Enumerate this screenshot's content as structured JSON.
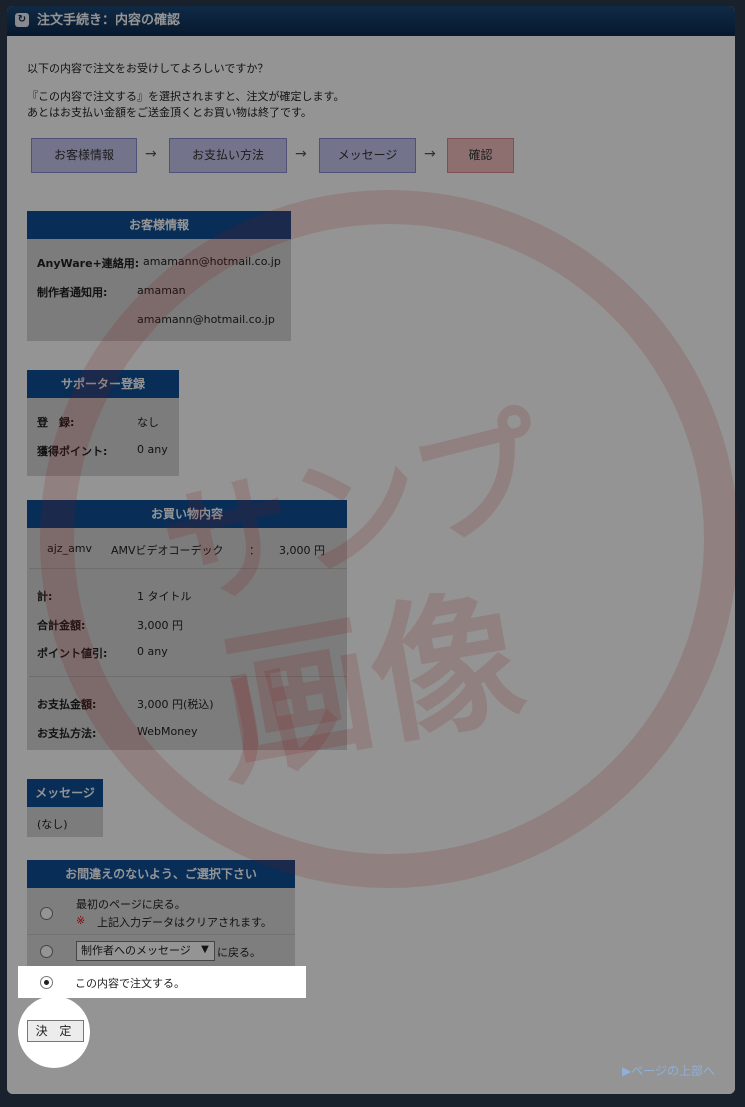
{
  "title": "注文手続き：内容の確認",
  "intro": {
    "line1": "以下の内容で注文をお受けしてよろしいですか？",
    "line2": "『この内容で注文する』を選択されますと、注文が確定します。",
    "line3": "あとはお支払い金額をご送金頂くとお買い物は終了です。"
  },
  "steps": [
    "お客様情報",
    "お支払い方法",
    "メッセージ",
    "確認"
  ],
  "step_arrow": "→",
  "customer": {
    "heading": "お客様情報",
    "anyware_label": "AnyWare+連絡用:",
    "anyware_value": "amamann@hotmail.co.jp",
    "creator_label": "制作者通知用:",
    "creator_name": "amaman",
    "creator_email": "amamann@hotmail.co.jp"
  },
  "supporter": {
    "heading": "サポーター登録",
    "reg_label": "登　録:",
    "reg_value": "なし",
    "points_label": "獲得ポイント:",
    "points_value": "0 any"
  },
  "purchase": {
    "heading": "お買い物内容",
    "item_code": "ajz_amv",
    "item_name": "AMVビデオコーデック",
    "item_colon": "：",
    "item_price": "3,000 円",
    "total_label": "計:",
    "total_value": "1 タイトル",
    "sum_label": "合計金額:",
    "sum_value": "3,000 円",
    "discount_label": "ポイント値引:",
    "discount_value": "0 any",
    "pay_amount_label": "お支払金額:",
    "pay_amount_value": "3,000 円(税込)",
    "pay_method_label": "お支払方法:",
    "pay_method_value": "WebMoney"
  },
  "message": {
    "heading": "メッセージ",
    "value": "(なし)"
  },
  "selection": {
    "heading": "お間違えのないよう、ご選択下さい",
    "option1": "最初のページに戻る。",
    "option1_mark": "※",
    "option1_note": "上記入力データはクリアされます。",
    "option2_select": "制作者へのメッセージ",
    "option2_suffix": "に戻る。",
    "option3": "この内容で注文する。"
  },
  "submit_label": "決 定",
  "page_top_link": "ページの上部へ",
  "watermark": {
    "line1": "サンプル",
    "line2": "画像"
  },
  "colors": {
    "header_bg": "#0e4f96",
    "step_bg": "#c7c8ef",
    "step_active_bg": "#f3c0c2",
    "watermark": "#e12828"
  }
}
